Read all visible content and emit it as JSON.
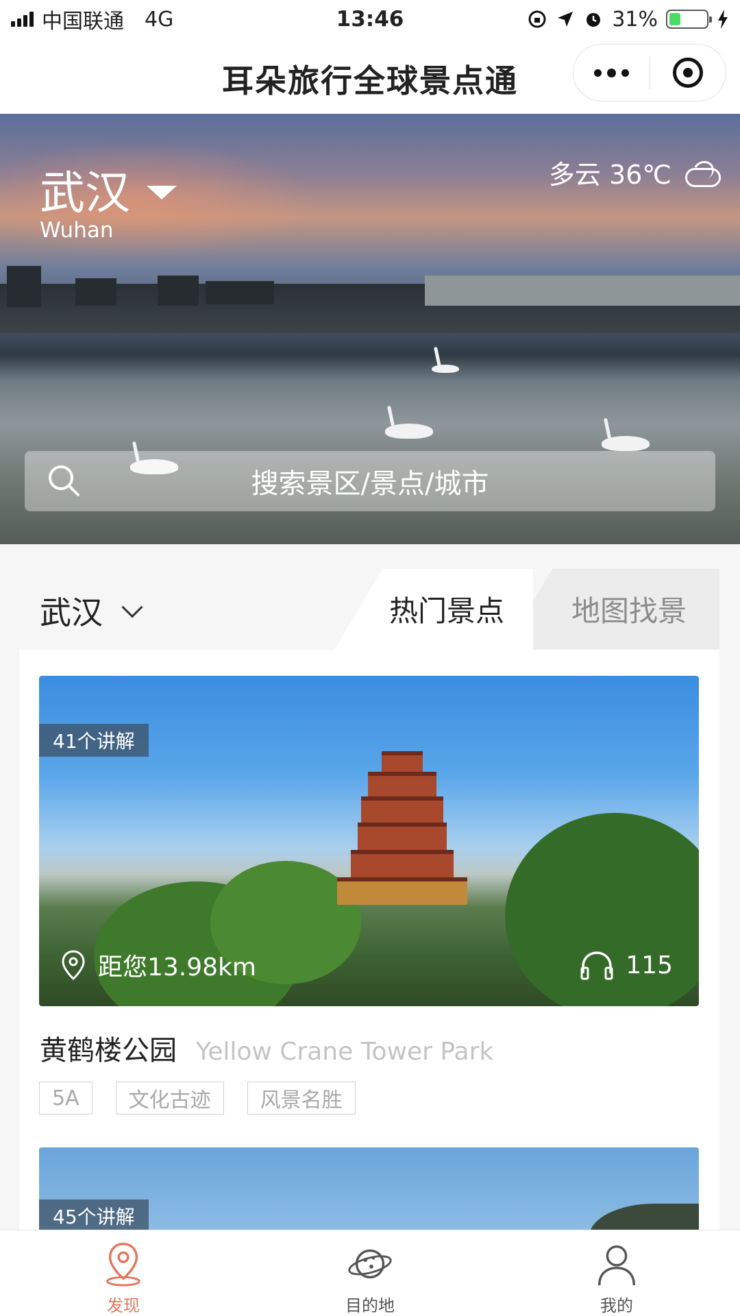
{
  "status_bar": {
    "carrier": "中国联通",
    "network": "4G",
    "time": "13:46",
    "battery_percent": "31%",
    "battery_level": 0.31
  },
  "nav": {
    "title": "耳朵旅行全球景点通"
  },
  "hero": {
    "city": "武汉",
    "city_en": "Wuhan",
    "weather": "多云 36℃",
    "search_placeholder": "搜索景区/景点/城市"
  },
  "filter": {
    "city": "武汉",
    "tabs": [
      {
        "label": "热门景点",
        "active": true
      },
      {
        "label": "地图找景",
        "active": false
      }
    ]
  },
  "cards": [
    {
      "badge": "41个讲解",
      "distance": "距您13.98km",
      "listens": "115",
      "name_zh": "黄鹤楼公园",
      "name_en": "Yellow Crane Tower Park",
      "tags": [
        "5A",
        "文化古迹",
        "风景名胜"
      ]
    },
    {
      "badge": "45个讲解"
    }
  ],
  "tabbar": {
    "items": [
      {
        "label": "发现",
        "icon": "location-pin-icon",
        "active": true
      },
      {
        "label": "目的地",
        "icon": "planet-icon",
        "active": false
      },
      {
        "label": "我的",
        "icon": "user-icon",
        "active": false
      }
    ]
  },
  "colors": {
    "accent": "#e4765d",
    "battery": "#4cd964",
    "tag_border": "#d2d2d2"
  }
}
